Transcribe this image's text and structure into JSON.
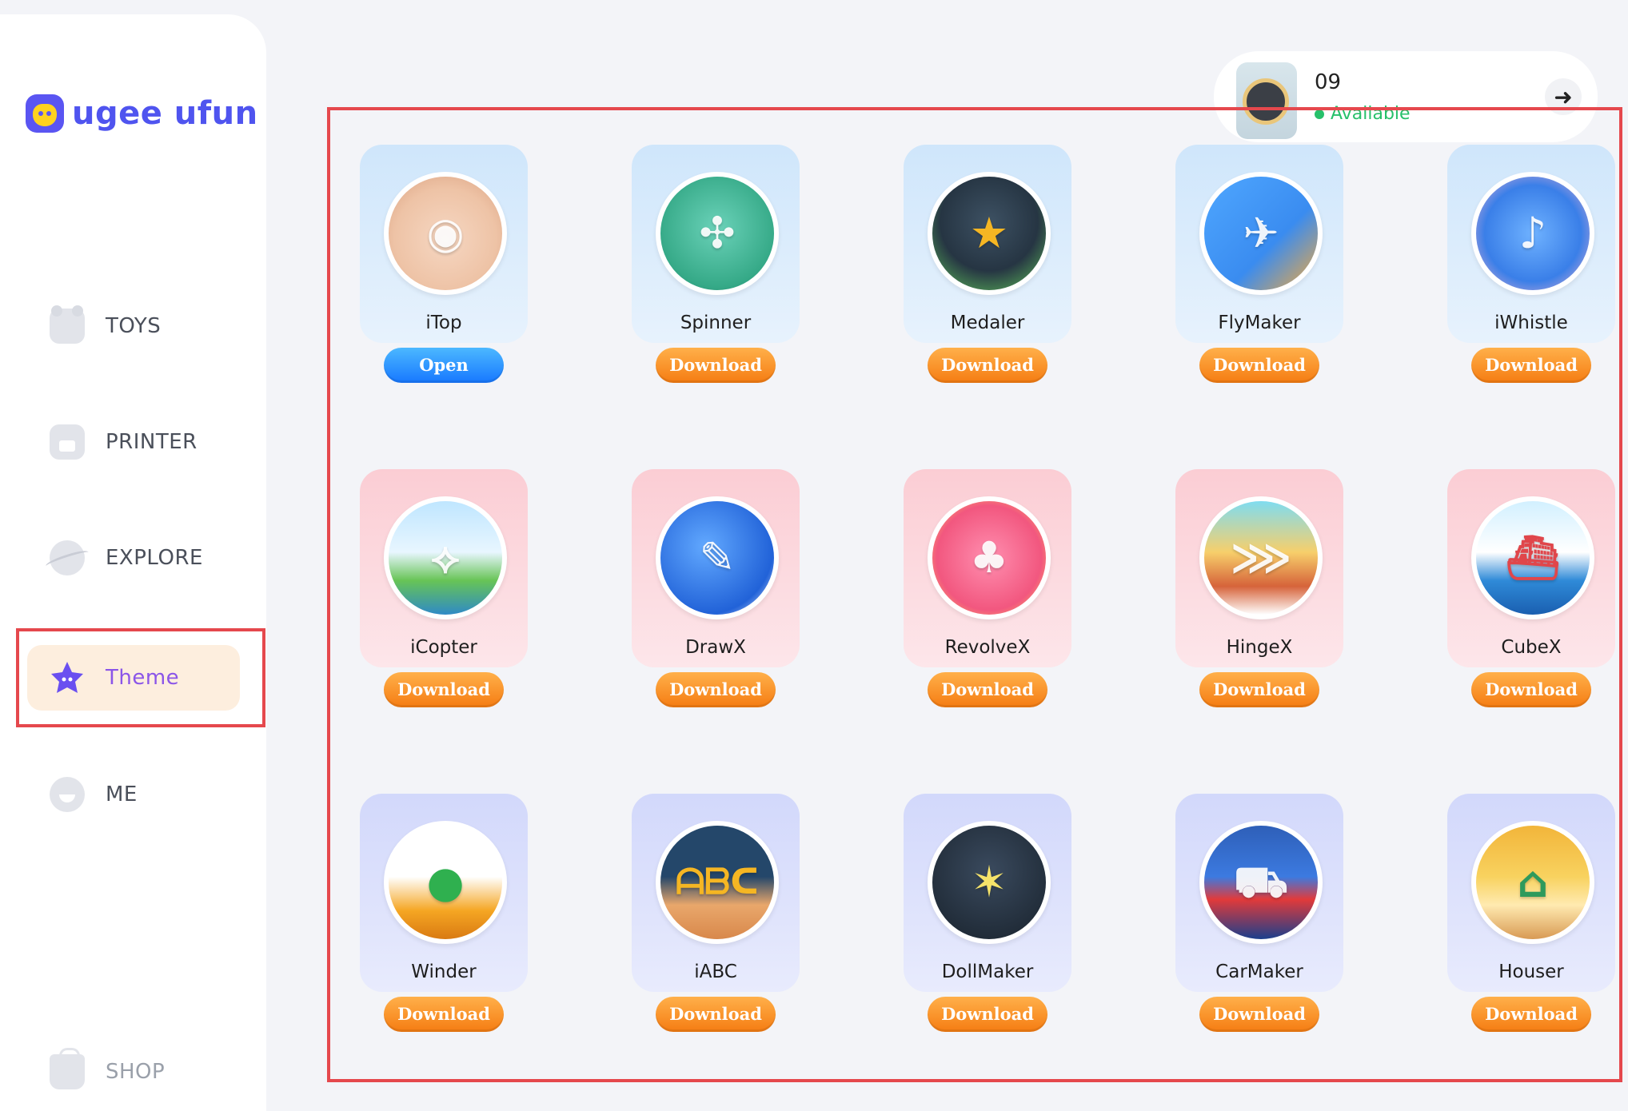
{
  "brand": {
    "name": "ugee ufun"
  },
  "nav": {
    "items": [
      {
        "label": "TOYS",
        "icon": "toy-bear-icon"
      },
      {
        "label": "PRINTER",
        "icon": "printer-icon"
      },
      {
        "label": "EXPLORE",
        "icon": "planet-icon"
      },
      {
        "label": "Theme",
        "icon": "star-icon",
        "active": true
      },
      {
        "label": "ME",
        "icon": "face-icon"
      }
    ],
    "shop": {
      "label": "SHOP",
      "icon": "shop-bag-icon"
    }
  },
  "device": {
    "name": "09",
    "status": "Available",
    "status_color": "#27c06a"
  },
  "apps": [
    {
      "name": "iTop",
      "button": "Open",
      "theme": "blue",
      "icon": "itop-icon"
    },
    {
      "name": "Spinner",
      "button": "Download",
      "theme": "blue",
      "icon": "spinner-icon"
    },
    {
      "name": "Medaler",
      "button": "Download",
      "theme": "blue",
      "icon": "medaler-icon"
    },
    {
      "name": "FlyMaker",
      "button": "Download",
      "theme": "blue",
      "icon": "flymaker-icon"
    },
    {
      "name": "iWhistle",
      "button": "Download",
      "theme": "blue",
      "icon": "iwhistle-icon"
    },
    {
      "name": "iCopter",
      "button": "Download",
      "theme": "pink",
      "icon": "icopter-icon"
    },
    {
      "name": "DrawX",
      "button": "Download",
      "theme": "pink",
      "icon": "drawx-icon"
    },
    {
      "name": "RevolveX",
      "button": "Download",
      "theme": "pink",
      "icon": "revolvex-icon"
    },
    {
      "name": "HingeX",
      "button": "Download",
      "theme": "pink",
      "icon": "hingex-icon"
    },
    {
      "name": "CubeX",
      "button": "Download",
      "theme": "pink",
      "icon": "cubex-icon"
    },
    {
      "name": "Winder",
      "button": "Download",
      "theme": "lilac",
      "icon": "winder-icon"
    },
    {
      "name": "iABC",
      "button": "Download",
      "theme": "lilac",
      "icon": "iabc-icon"
    },
    {
      "name": "DollMaker",
      "button": "Download",
      "theme": "lilac",
      "icon": "dollmaker-icon"
    },
    {
      "name": "CarMaker",
      "button": "Download",
      "theme": "lilac",
      "icon": "carmaker-icon"
    },
    {
      "name": "Houser",
      "button": "Download",
      "theme": "lilac",
      "icon": "houser-icon"
    }
  ],
  "colors": {
    "brand": "#4f54ef",
    "active_nav_bg": "#fdeede",
    "active_nav_text": "#8b55e8",
    "download_button": "#f57c12",
    "open_button": "#1778ff",
    "highlight_border": "#e5484d"
  }
}
